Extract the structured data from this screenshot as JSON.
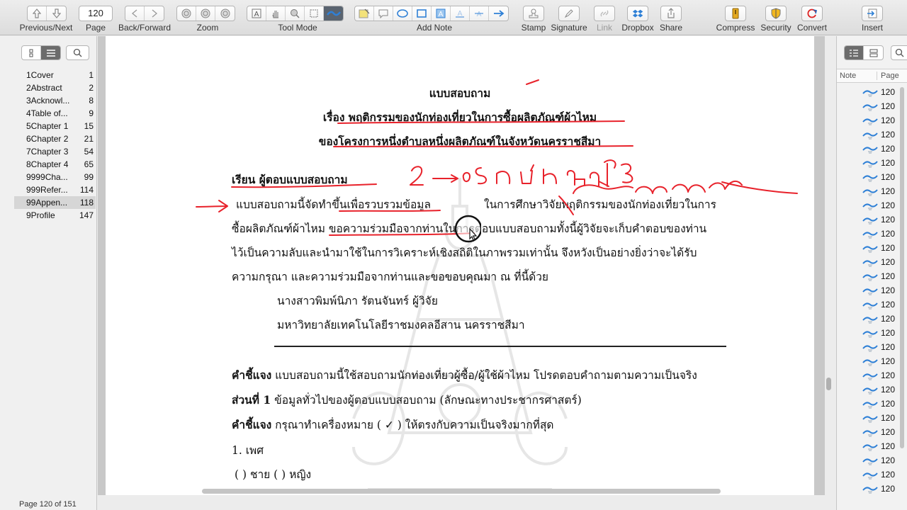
{
  "toolbar": {
    "prevnext_label": "Previous/Next",
    "page_label": "Page",
    "page_value": "120",
    "backforward_label": "Back/Forward",
    "zoom_label": "Zoom",
    "toolmode_label": "Tool Mode",
    "addnote_label": "Add Note",
    "stamp_label": "Stamp",
    "signature_label": "Signature",
    "link_label": "Link",
    "dropbox_label": "Dropbox",
    "share_label": "Share",
    "compress_label": "Compress",
    "security_label": "Security",
    "convert_label": "Convert",
    "insert_label": "Insert"
  },
  "outline": [
    {
      "title": "1Cover",
      "page": "1"
    },
    {
      "title": "2Abstract",
      "page": "2"
    },
    {
      "title": "3Acknowl...",
      "page": "8"
    },
    {
      "title": "4Table of...",
      "page": "9"
    },
    {
      "title": "5Chapter 1",
      "page": "15"
    },
    {
      "title": "6Chapter 2",
      "page": "21"
    },
    {
      "title": "7Chapter 3",
      "page": "54"
    },
    {
      "title": "8Chapter 4",
      "page": "65"
    },
    {
      "title": "9999Cha...",
      "page": "99"
    },
    {
      "title": "999Refer...",
      "page": "114"
    },
    {
      "title": "99Appen...",
      "page": "118"
    },
    {
      "title": "9Profile",
      "page": "147"
    }
  ],
  "status": "Page 120 of 151",
  "document": {
    "title": "แบบสอบถาม",
    "subject_line1": "เรื่อง พฤติกรรมของนักท่องเที่ยวในการซื้อผลิตภัณฑ์ผ้าไหม",
    "subject_line2": "ของโครงการหนึ่งตำบลหนึ่งผลิตภัณฑ์ในจังหวัดนครราชสีมา",
    "salutation": "เรียน ผู้ตอบแบบสอบถาม",
    "para1_a": "แบบสอบถามนี้จัดทำขึ้นเพื่อรวบรวมข้อมูล",
    "para1_b": "ในการศึกษาวิจัยพฤติกรรมของนักท่องเที่ยวในการ",
    "para2": "ซื้อผลิตภัณฑ์ผ้าไหม ขอความร่วมมือจากท่านในการตอบแบบสอบถามทั้งนี้ผู้วิจัยจะเก็บคำตอบของท่าน",
    "para3": "ไว้เป็นความลับและนำมาใช้ในการวิเคราะห์เชิงสถิติในภาพรวมเท่านั้น จึงหวังเป็นอย่างยิ่งว่าจะได้รับ",
    "para4": "ความกรุณา และความร่วมมือจากท่านและขอขอบคุณมา ณ ที่นี้ด้วย",
    "researcher": "นางสาวพิมพ์นิภา  รัตนจันทร์  ผู้วิจัย",
    "university": "มหาวิทยาลัยเทคโนโลยีราชมงคลอีสาน นครราชสีมา",
    "instruction1_bold": "คำชี้แจง",
    "instruction1_rest": " แบบสอบถามนี้ใช้สอบถามนักท่องเที่ยวผู้ซื้อ/ผู้ใช้ผ้าไหม โปรดตอบคำถามตามความเป็นจริง",
    "part1_bold": "ส่วนที่ 1",
    "part1_rest": " ข้อมูลทั่วไปของผู้ตอบแบบสอบถาม (ลักษณะทางประชากรศาสตร์)",
    "instruction2_bold": "คำชี้แจง",
    "instruction2_rest": " กรุณาทำเครื่องหมาย ( ✓ ) ให้ตรงกับความเป็นจริงมากที่สุด",
    "q1": "1. เพศ",
    "q1_options": "( )  ชาย   ( )  หญิง"
  },
  "notes_panel": {
    "col_note": "Note",
    "col_page": "Page",
    "item_page": "120",
    "item_count": 29
  },
  "colors": {
    "ink": "#e8222b",
    "highlight_icon": "#2f80d6",
    "active_tool": "#5a6470"
  }
}
